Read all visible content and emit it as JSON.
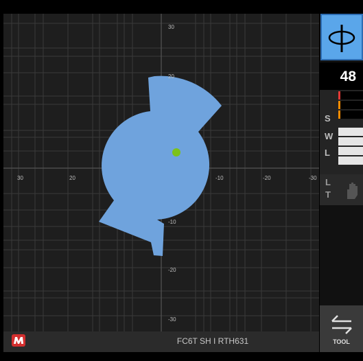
{
  "gain": {
    "value": "48"
  },
  "meters": {
    "labels": [
      "S",
      "W",
      "L",
      "L",
      "T"
    ],
    "s_bars": [
      {
        "color": "#e53935",
        "level": 0.0
      },
      {
        "color": "#fb8c00",
        "level": 0.0
      },
      {
        "color": "#fb8c00",
        "level": 0.0
      }
    ]
  },
  "tool": {
    "label": "TOOL"
  },
  "footer": {
    "status_text": "FC6T SH I RTH631"
  },
  "plot": {
    "x_ticks_left": [
      "30",
      "20"
    ],
    "x_ticks_right": [
      "-10",
      "-20",
      "-30"
    ],
    "y_ticks_top": [
      "30",
      "20"
    ],
    "y_ticks_bottom": [
      "-10",
      "-20",
      "-30"
    ],
    "shape_color": "#6fa3dd",
    "marker_color": "#7cc21a"
  }
}
